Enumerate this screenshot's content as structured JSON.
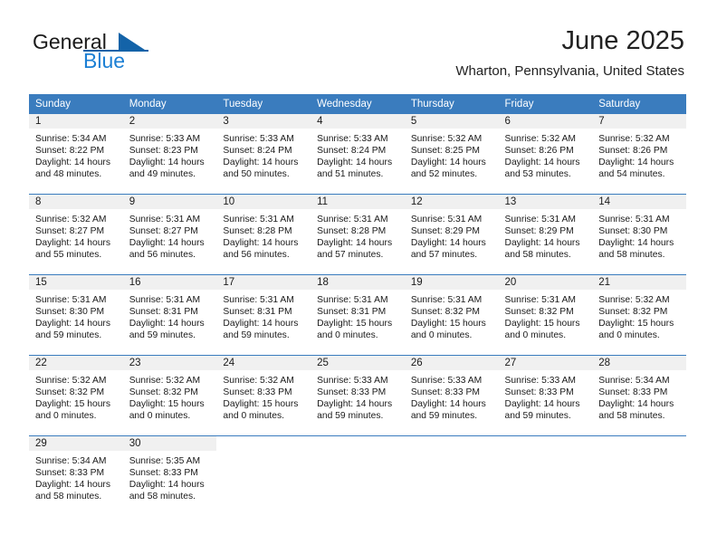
{
  "brand": {
    "name_part1": "General",
    "name_part2": "Blue",
    "logo_icon": "triangle-logo-icon"
  },
  "header": {
    "month_title": "June 2025",
    "location": "Wharton, Pennsylvania, United States"
  },
  "calendar": {
    "weekday_headers": [
      "Sunday",
      "Monday",
      "Tuesday",
      "Wednesday",
      "Thursday",
      "Friday",
      "Saturday"
    ],
    "header_bg": "#3a7cbe",
    "daynum_bg": "#f0f0f0",
    "row_separator_color": "#3a7cbe",
    "weeks": [
      [
        {
          "day": "1",
          "sunrise": "Sunrise: 5:34 AM",
          "sunset": "Sunset: 8:22 PM",
          "daylight_line1": "Daylight: 14 hours",
          "daylight_line2": "and 48 minutes."
        },
        {
          "day": "2",
          "sunrise": "Sunrise: 5:33 AM",
          "sunset": "Sunset: 8:23 PM",
          "daylight_line1": "Daylight: 14 hours",
          "daylight_line2": "and 49 minutes."
        },
        {
          "day": "3",
          "sunrise": "Sunrise: 5:33 AM",
          "sunset": "Sunset: 8:24 PM",
          "daylight_line1": "Daylight: 14 hours",
          "daylight_line2": "and 50 minutes."
        },
        {
          "day": "4",
          "sunrise": "Sunrise: 5:33 AM",
          "sunset": "Sunset: 8:24 PM",
          "daylight_line1": "Daylight: 14 hours",
          "daylight_line2": "and 51 minutes."
        },
        {
          "day": "5",
          "sunrise": "Sunrise: 5:32 AM",
          "sunset": "Sunset: 8:25 PM",
          "daylight_line1": "Daylight: 14 hours",
          "daylight_line2": "and 52 minutes."
        },
        {
          "day": "6",
          "sunrise": "Sunrise: 5:32 AM",
          "sunset": "Sunset: 8:26 PM",
          "daylight_line1": "Daylight: 14 hours",
          "daylight_line2": "and 53 minutes."
        },
        {
          "day": "7",
          "sunrise": "Sunrise: 5:32 AM",
          "sunset": "Sunset: 8:26 PM",
          "daylight_line1": "Daylight: 14 hours",
          "daylight_line2": "and 54 minutes."
        }
      ],
      [
        {
          "day": "8",
          "sunrise": "Sunrise: 5:32 AM",
          "sunset": "Sunset: 8:27 PM",
          "daylight_line1": "Daylight: 14 hours",
          "daylight_line2": "and 55 minutes."
        },
        {
          "day": "9",
          "sunrise": "Sunrise: 5:31 AM",
          "sunset": "Sunset: 8:27 PM",
          "daylight_line1": "Daylight: 14 hours",
          "daylight_line2": "and 56 minutes."
        },
        {
          "day": "10",
          "sunrise": "Sunrise: 5:31 AM",
          "sunset": "Sunset: 8:28 PM",
          "daylight_line1": "Daylight: 14 hours",
          "daylight_line2": "and 56 minutes."
        },
        {
          "day": "11",
          "sunrise": "Sunrise: 5:31 AM",
          "sunset": "Sunset: 8:28 PM",
          "daylight_line1": "Daylight: 14 hours",
          "daylight_line2": "and 57 minutes."
        },
        {
          "day": "12",
          "sunrise": "Sunrise: 5:31 AM",
          "sunset": "Sunset: 8:29 PM",
          "daylight_line1": "Daylight: 14 hours",
          "daylight_line2": "and 57 minutes."
        },
        {
          "day": "13",
          "sunrise": "Sunrise: 5:31 AM",
          "sunset": "Sunset: 8:29 PM",
          "daylight_line1": "Daylight: 14 hours",
          "daylight_line2": "and 58 minutes."
        },
        {
          "day": "14",
          "sunrise": "Sunrise: 5:31 AM",
          "sunset": "Sunset: 8:30 PM",
          "daylight_line1": "Daylight: 14 hours",
          "daylight_line2": "and 58 minutes."
        }
      ],
      [
        {
          "day": "15",
          "sunrise": "Sunrise: 5:31 AM",
          "sunset": "Sunset: 8:30 PM",
          "daylight_line1": "Daylight: 14 hours",
          "daylight_line2": "and 59 minutes."
        },
        {
          "day": "16",
          "sunrise": "Sunrise: 5:31 AM",
          "sunset": "Sunset: 8:31 PM",
          "daylight_line1": "Daylight: 14 hours",
          "daylight_line2": "and 59 minutes."
        },
        {
          "day": "17",
          "sunrise": "Sunrise: 5:31 AM",
          "sunset": "Sunset: 8:31 PM",
          "daylight_line1": "Daylight: 14 hours",
          "daylight_line2": "and 59 minutes."
        },
        {
          "day": "18",
          "sunrise": "Sunrise: 5:31 AM",
          "sunset": "Sunset: 8:31 PM",
          "daylight_line1": "Daylight: 15 hours",
          "daylight_line2": "and 0 minutes."
        },
        {
          "day": "19",
          "sunrise": "Sunrise: 5:31 AM",
          "sunset": "Sunset: 8:32 PM",
          "daylight_line1": "Daylight: 15 hours",
          "daylight_line2": "and 0 minutes."
        },
        {
          "day": "20",
          "sunrise": "Sunrise: 5:31 AM",
          "sunset": "Sunset: 8:32 PM",
          "daylight_line1": "Daylight: 15 hours",
          "daylight_line2": "and 0 minutes."
        },
        {
          "day": "21",
          "sunrise": "Sunrise: 5:32 AM",
          "sunset": "Sunset: 8:32 PM",
          "daylight_line1": "Daylight: 15 hours",
          "daylight_line2": "and 0 minutes."
        }
      ],
      [
        {
          "day": "22",
          "sunrise": "Sunrise: 5:32 AM",
          "sunset": "Sunset: 8:32 PM",
          "daylight_line1": "Daylight: 15 hours",
          "daylight_line2": "and 0 minutes."
        },
        {
          "day": "23",
          "sunrise": "Sunrise: 5:32 AM",
          "sunset": "Sunset: 8:32 PM",
          "daylight_line1": "Daylight: 15 hours",
          "daylight_line2": "and 0 minutes."
        },
        {
          "day": "24",
          "sunrise": "Sunrise: 5:32 AM",
          "sunset": "Sunset: 8:33 PM",
          "daylight_line1": "Daylight: 15 hours",
          "daylight_line2": "and 0 minutes."
        },
        {
          "day": "25",
          "sunrise": "Sunrise: 5:33 AM",
          "sunset": "Sunset: 8:33 PM",
          "daylight_line1": "Daylight: 14 hours",
          "daylight_line2": "and 59 minutes."
        },
        {
          "day": "26",
          "sunrise": "Sunrise: 5:33 AM",
          "sunset": "Sunset: 8:33 PM",
          "daylight_line1": "Daylight: 14 hours",
          "daylight_line2": "and 59 minutes."
        },
        {
          "day": "27",
          "sunrise": "Sunrise: 5:33 AM",
          "sunset": "Sunset: 8:33 PM",
          "daylight_line1": "Daylight: 14 hours",
          "daylight_line2": "and 59 minutes."
        },
        {
          "day": "28",
          "sunrise": "Sunrise: 5:34 AM",
          "sunset": "Sunset: 8:33 PM",
          "daylight_line1": "Daylight: 14 hours",
          "daylight_line2": "and 58 minutes."
        }
      ],
      [
        {
          "day": "29",
          "sunrise": "Sunrise: 5:34 AM",
          "sunset": "Sunset: 8:33 PM",
          "daylight_line1": "Daylight: 14 hours",
          "daylight_line2": "and 58 minutes."
        },
        {
          "day": "30",
          "sunrise": "Sunrise: 5:35 AM",
          "sunset": "Sunset: 8:33 PM",
          "daylight_line1": "Daylight: 14 hours",
          "daylight_line2": "and 58 minutes."
        },
        {
          "day": "",
          "sunrise": "",
          "sunset": "",
          "daylight_line1": "",
          "daylight_line2": ""
        },
        {
          "day": "",
          "sunrise": "",
          "sunset": "",
          "daylight_line1": "",
          "daylight_line2": ""
        },
        {
          "day": "",
          "sunrise": "",
          "sunset": "",
          "daylight_line1": "",
          "daylight_line2": ""
        },
        {
          "day": "",
          "sunrise": "",
          "sunset": "",
          "daylight_line1": "",
          "daylight_line2": ""
        },
        {
          "day": "",
          "sunrise": "",
          "sunset": "",
          "daylight_line1": "",
          "daylight_line2": ""
        }
      ]
    ]
  }
}
